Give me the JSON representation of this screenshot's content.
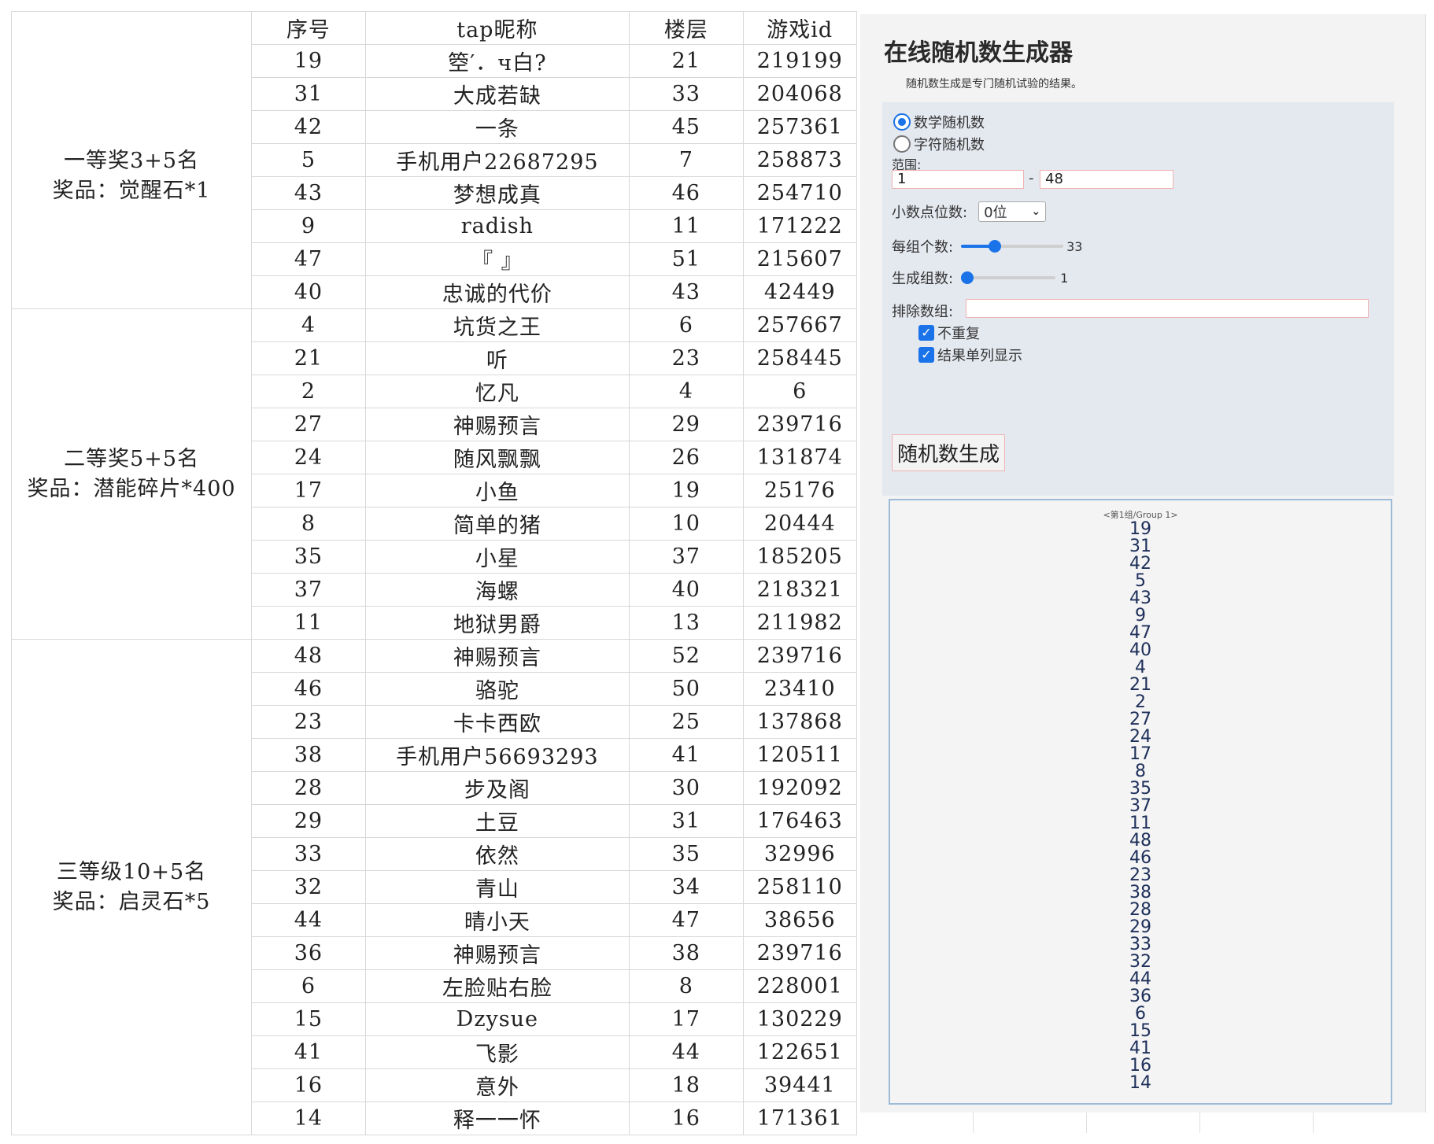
{
  "table": {
    "headers": [
      "序号",
      "tap昵称",
      "楼层",
      "游戏id"
    ],
    "groups": [
      {
        "label": [
          "一等奖3+5名",
          "奖品：觉醒石*1"
        ],
        "rows": [
          [
            "19",
            "箜′．ч白?",
            "21",
            "219199"
          ],
          [
            "31",
            "大成若缺",
            "33",
            "204068"
          ],
          [
            "42",
            "一条",
            "45",
            "257361"
          ],
          [
            "5",
            "手机用户22687295",
            "7",
            "258873"
          ],
          [
            "43",
            "梦想成真",
            "46",
            "254710"
          ],
          [
            "9",
            "radish",
            "11",
            "171222"
          ],
          [
            "47",
            "『 』",
            "51",
            "215607"
          ],
          [
            "40",
            "忠诚的代价",
            "43",
            "42449"
          ]
        ]
      },
      {
        "label": [
          "二等奖5+5名",
          "奖品：潜能碎片*400"
        ],
        "rows": [
          [
            "4",
            "坑货之王",
            "6",
            "257667"
          ],
          [
            "21",
            "听",
            "23",
            "258445"
          ],
          [
            "2",
            "忆凡",
            "4",
            "6"
          ],
          [
            "27",
            "神赐预言",
            "29",
            "239716"
          ],
          [
            "24",
            "随风飘飘",
            "26",
            "131874"
          ],
          [
            "17",
            "小鱼",
            "19",
            "25176"
          ],
          [
            "8",
            "简单的猪",
            "10",
            "20444"
          ],
          [
            "35",
            "小星",
            "37",
            "185205"
          ],
          [
            "37",
            "海螺",
            "40",
            "218321"
          ],
          [
            "11",
            "地狱男爵",
            "13",
            "211982"
          ]
        ]
      },
      {
        "label": [
          "三等级10+5名",
          "奖品：启灵石*5"
        ],
        "rows": [
          [
            "48",
            "神赐预言",
            "52",
            "239716"
          ],
          [
            "46",
            "骆驼",
            "50",
            "23410"
          ],
          [
            "23",
            "卡卡西欧",
            "25",
            "137868"
          ],
          [
            "38",
            "手机用户56693293",
            "41",
            "120511"
          ],
          [
            "28",
            "步及阁",
            "30",
            "192092"
          ],
          [
            "29",
            "土豆",
            "31",
            "176463"
          ],
          [
            "33",
            "依然",
            "35",
            "32996"
          ],
          [
            "32",
            "青山",
            "34",
            "258110"
          ],
          [
            "44",
            "晴小天",
            "47",
            "38656"
          ],
          [
            "36",
            "神赐预言",
            "38",
            "239716"
          ],
          [
            "6",
            "左脸贴右脸",
            "8",
            "228001"
          ],
          [
            "15",
            "Dzysue",
            "17",
            "130229"
          ],
          [
            "41",
            "飞影",
            "44",
            "122651"
          ],
          [
            "16",
            "意外",
            "18",
            "39441"
          ],
          [
            "14",
            "释一一怀",
            "16",
            "171361"
          ]
        ]
      }
    ]
  },
  "generator": {
    "title": "在线随机数生成器",
    "subtitle": "随机数生成是专门随机试验的结果。",
    "mode_options": [
      "数学随机数",
      "字符随机数"
    ],
    "mode_selected": 0,
    "range_label": "范围:",
    "range_min": "1",
    "range_sep": "-",
    "range_max": "48",
    "decimal_label": "小数点位数:",
    "decimal_value": "0位",
    "per_group_label": "每组个数:",
    "per_group_value": "33",
    "per_group_level": 0.33,
    "groups_label": "生成组数:",
    "groups_value": "1",
    "groups_level": 0.02,
    "exclude_label": "排除数组:",
    "exclude_value": "",
    "no_repeat_label": "不重复",
    "no_repeat_checked": true,
    "single_column_label": "结果单列显示",
    "single_column_checked": true,
    "button_label": "随机数生成",
    "result_header": "<第1组/Group 1>",
    "results": [
      "19",
      "31",
      "42",
      "5",
      "43",
      "9",
      "47",
      "40",
      "4",
      "21",
      "2",
      "27",
      "24",
      "17",
      "8",
      "35",
      "37",
      "11",
      "48",
      "46",
      "23",
      "38",
      "28",
      "29",
      "33",
      "32",
      "44",
      "36",
      "6",
      "15",
      "41",
      "16",
      "14"
    ]
  },
  "colors": {
    "accent": "#1a73e8",
    "input_border": "#f0b3b3",
    "form_bg": "#e4e8ef",
    "result_border": "#9dbbd6"
  }
}
